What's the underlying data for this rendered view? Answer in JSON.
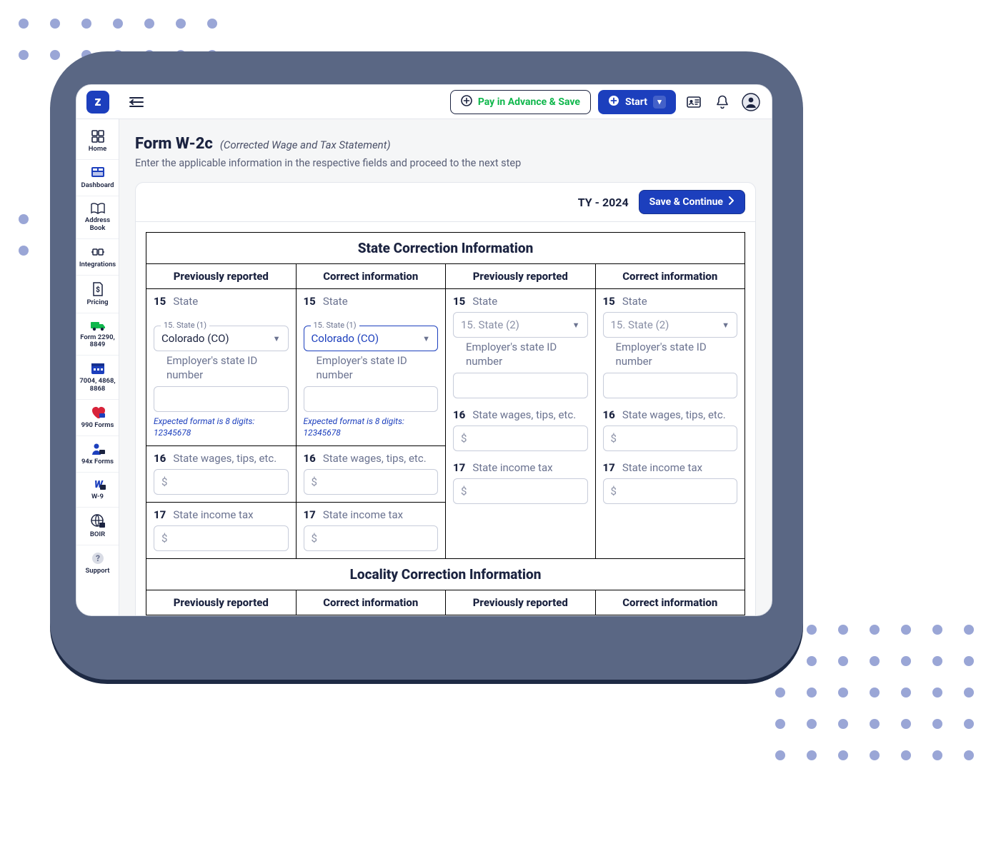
{
  "colors": {
    "primary": "#1c3fbd",
    "slate": "#5a6784",
    "text": "#1b2340",
    "muted": "#6b7390",
    "green": "#0fb74c"
  },
  "topbar": {
    "logo_letter": "z",
    "pay_label": "Pay in Advance & Save",
    "start_label": "Start"
  },
  "sidebar": {
    "items": [
      {
        "label": "Home",
        "icon": "home",
        "color": "#1b2340"
      },
      {
        "label": "Dashboard",
        "icon": "dashboard",
        "color": "#1c3fbd"
      },
      {
        "label": "Address Book",
        "icon": "book",
        "color": "#1b2340"
      },
      {
        "label": "Integrations",
        "icon": "integrations",
        "color": "#1b2340"
      },
      {
        "label": "Pricing",
        "icon": "pricing",
        "color": "#1b2340"
      },
      {
        "label": "Form 2290, 8849",
        "icon": "truck",
        "color": "#0fb74c"
      },
      {
        "label": "7004, 4868, 8868",
        "icon": "calendar",
        "color": "#1c3fbd"
      },
      {
        "label": "990 Forms",
        "icon": "heart",
        "color": "#d8233a"
      },
      {
        "label": "94x Forms",
        "icon": "person",
        "color": "#1c3fbd"
      },
      {
        "label": "W-9",
        "icon": "w9",
        "color": "#1c3fbd"
      },
      {
        "label": "BOIR",
        "icon": "globe",
        "color": "#1b2340"
      },
      {
        "label": "Support",
        "icon": "support",
        "color": "#8a90a6"
      }
    ]
  },
  "page": {
    "title": "Form W-2c",
    "subtitle": "(Corrected Wage and Tax Statement)",
    "description": "Enter the applicable information in the respective fields and proceed to the next step",
    "tax_year": "TY - 2024",
    "save_continue": "Save & Continue"
  },
  "state_section": {
    "title": "State Correction Information",
    "col_prev": "Previously reported",
    "col_corr": "Correct information",
    "line15": {
      "num": "15",
      "label": "State"
    },
    "state1_legend": "15. State (1)",
    "state2_placeholder": "15. State (2)",
    "state_value": "Colorado (CO)",
    "emp_state_id_label": "Employer's state ID number",
    "hint": "Expected format is 8 digits: 12345678",
    "line16": {
      "num": "16",
      "label": "State wages, tips, etc."
    },
    "line17": {
      "num": "17",
      "label": "State income tax"
    },
    "currency": "$"
  },
  "locality_section": {
    "title": "Locality Correction Information",
    "col_prev": "Previously reported",
    "col_corr": "Correct information"
  }
}
